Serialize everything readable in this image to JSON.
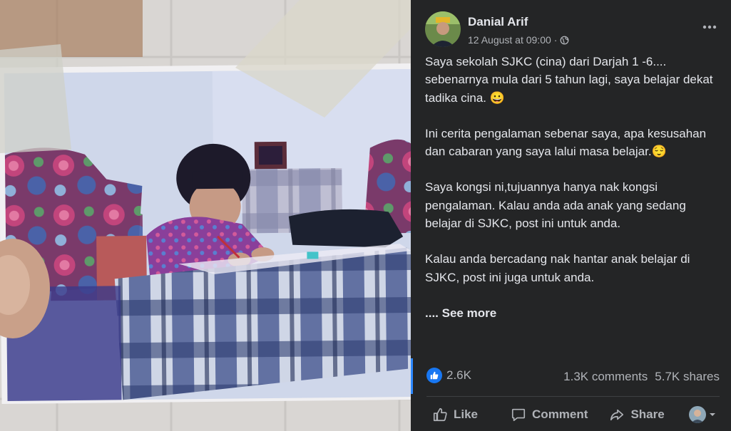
{
  "post": {
    "author": "Danial Arif",
    "timestamp": "12 August at 09:00",
    "separator": "·",
    "audience_icon": "globe-icon",
    "more_icon": "more-options-icon",
    "paragraphs": [
      "Saya sekolah SJKC (cina) dari Darjah 1 -6.... sebenarnya mula dari 5 tahun lagi, saya belajar dekat tadika cina. 😀",
      "Ini cerita pengalaman sebenar saya, apa kesusahan dan cabaran yang saya lalui masa belajar.😌",
      "Saya kongsi ni,tujuannya hanya nak kongsi pengalaman. Kalau anda ada anak yang sedang belajar di SJKC, post ini untuk anda.",
      "Kalau anda bercadang nak hantar anak belajar di SJKC, post ini juga untuk anda."
    ],
    "see_more": ".... See more"
  },
  "stats": {
    "reaction_icon": "like-reaction-icon",
    "reactions": "2.6K",
    "comments": "1.3K comments",
    "shares": "5.7K shares"
  },
  "actions": {
    "like": "Like",
    "comment": "Comment",
    "share": "Share"
  },
  "colors": {
    "background": "#242526",
    "text_primary": "#e4e6eb",
    "text_secondary": "#b0b3b8",
    "accent": "#1877f2",
    "divider": "#3e4042"
  }
}
